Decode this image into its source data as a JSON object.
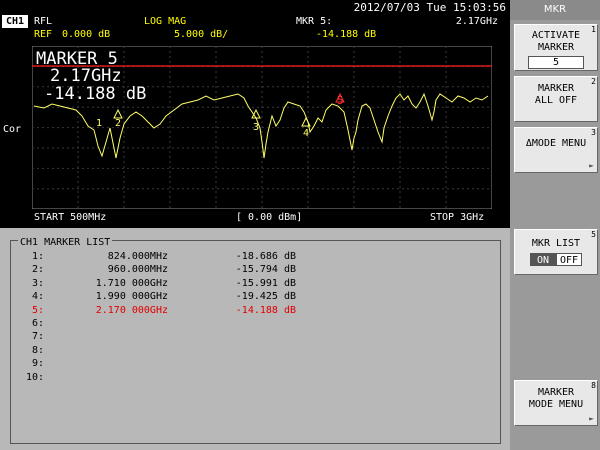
{
  "status": {
    "datetime": "2012/07/03 Tue 15:03:56"
  },
  "header": {
    "channel": "CH1",
    "mode": "RFL",
    "format": "LOG MAG",
    "marker_label": "MKR 5:",
    "marker_freq": "2.17GHz",
    "ref_label": "REF",
    "ref_value": "0.000 dB",
    "scale": "5.000 dB/",
    "marker_value": "-14.188 dB",
    "cor": "Cor"
  },
  "active_marker": {
    "title": "MARKER 5",
    "freq": "2.17GHz",
    "value": "-14.188 dB"
  },
  "plot_markers": [
    {
      "label": "1"
    },
    {
      "label": "2"
    },
    {
      "label": "3"
    },
    {
      "label": "4"
    },
    {
      "label": "5"
    }
  ],
  "footer": {
    "start": "START 500MHz",
    "power": "[ 0.00 dBm]",
    "stop": "STOP 3GHz"
  },
  "marker_list": {
    "title": "CH1 MARKER LIST",
    "rows": [
      {
        "idx": "1:",
        "freq": "824.000MHz",
        "value": "-18.686 dB"
      },
      {
        "idx": "2:",
        "freq": "960.000MHz",
        "value": "-15.794 dB"
      },
      {
        "idx": "3:",
        "freq": "1.710 000GHz",
        "value": "-15.991 dB"
      },
      {
        "idx": "4:",
        "freq": "1.990 000GHz",
        "value": "-19.425 dB"
      },
      {
        "idx": "5:",
        "freq": "2.170 000GHz",
        "value": "-14.188 dB"
      },
      {
        "idx": "6:",
        "freq": "",
        "value": ""
      },
      {
        "idx": "7:",
        "freq": "",
        "value": ""
      },
      {
        "idx": "8:",
        "freq": "",
        "value": ""
      },
      {
        "idx": "9:",
        "freq": "",
        "value": ""
      },
      {
        "idx": "10:",
        "freq": "",
        "value": ""
      }
    ]
  },
  "side_panel": {
    "title": "MKR",
    "activate_marker": {
      "line1": "ACTIVATE",
      "line2": "MARKER",
      "value": "5",
      "num": "1"
    },
    "marker_all_off": {
      "line1": "MARKER",
      "line2": "ALL OFF",
      "num": "2"
    },
    "delta_mode_menu": {
      "line1": "ΔMODE MENU",
      "num": "3"
    },
    "mkr_list": {
      "line1": "MKR LIST",
      "on": "ON",
      "off": "OFF",
      "num": "5"
    },
    "marker_mode_menu": {
      "line1": "MARKER",
      "line2": "MODE MENU",
      "num": "8"
    }
  },
  "colors": {
    "trace": "#ffff66",
    "ref_line": "#ff2020",
    "grid": "#3a3a3a",
    "active": "#ff3030"
  }
}
